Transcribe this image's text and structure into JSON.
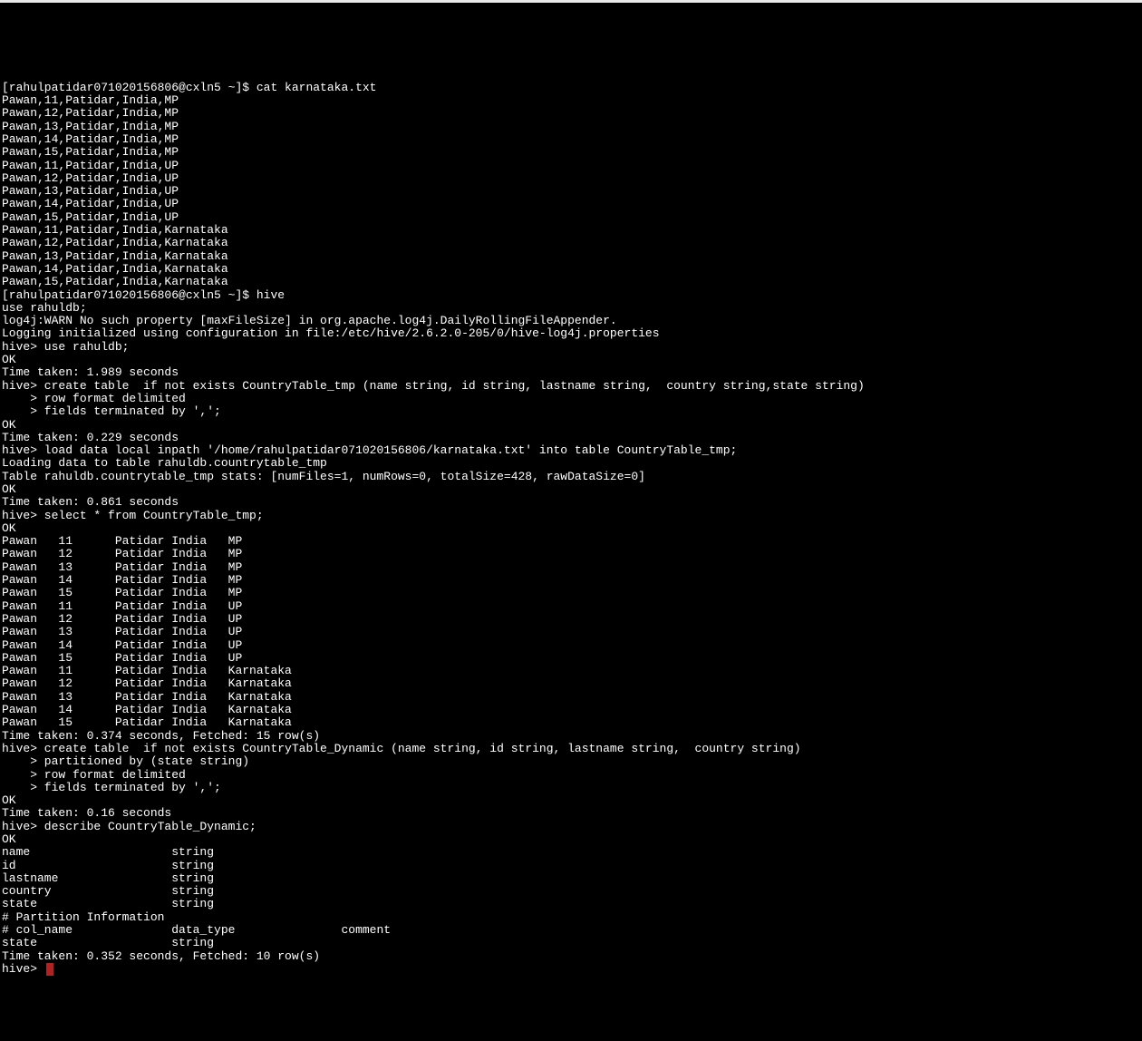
{
  "shell_user": "rahulpatidar071020156806",
  "shell_host": "cxln5",
  "cat_cmd": "[rahulpatidar071020156806@cxln5 ~]$ cat karnataka.txt",
  "cat_rows": [
    "Pawan,11,Patidar,India,MP",
    "Pawan,12,Patidar,India,MP",
    "Pawan,13,Patidar,India,MP",
    "Pawan,14,Patidar,India,MP",
    "Pawan,15,Patidar,India,MP",
    "Pawan,11,Patidar,India,UP",
    "Pawan,12,Patidar,India,UP",
    "Pawan,13,Patidar,India,UP",
    "Pawan,14,Patidar,India,UP",
    "Pawan,15,Patidar,India,UP",
    "Pawan,11,Patidar,India,Karnataka",
    "Pawan,12,Patidar,India,Karnataka",
    "Pawan,13,Patidar,India,Karnataka",
    "Pawan,14,Patidar,India,Karnataka",
    "Pawan,15,Patidar,India,Karnataka"
  ],
  "hive_cmd": "[rahulpatidar071020156806@cxln5 ~]$ hive",
  "use_db": "use rahuldb;",
  "log4j_warn": "log4j:WARN No such property [maxFileSize] in org.apache.log4j.DailyRollingFileAppender.",
  "blank": "",
  "logging_init": "Logging initialized using configuration in file:/etc/hive/2.6.2.0-205/0/hive-log4j.properties",
  "hive_use": "hive> use rahuldb;",
  "ok": "OK",
  "time_use": "Time taken: 1.989 seconds",
  "create_tmp_l1": "hive> create table  if not exists CountryTable_tmp (name string, id string, lastname string,  country string,state string)",
  "create_tmp_l2": "    > row format delimited",
  "create_tmp_l3": "    > fields terminated by ',';",
  "time_create_tmp": "Time taken: 0.229 seconds",
  "load_cmd": "hive> load data local inpath '/home/rahulpatidar071020156806/karnataka.txt' into table CountryTable_tmp;",
  "loading": "Loading data to table rahuldb.countrytable_tmp",
  "stats": "Table rahuldb.countrytable_tmp stats: [numFiles=1, numRows=0, totalSize=428, rawDataSize=0]",
  "time_load": "Time taken: 0.861 seconds",
  "select_cmd": "hive> select * from CountryTable_tmp;",
  "select_rows": [
    {
      "name": "Pawan",
      "id": "11",
      "ln": "Patidar",
      "country": "India",
      "state": "MP"
    },
    {
      "name": "Pawan",
      "id": "12",
      "ln": "Patidar",
      "country": "India",
      "state": "MP"
    },
    {
      "name": "Pawan",
      "id": "13",
      "ln": "Patidar",
      "country": "India",
      "state": "MP"
    },
    {
      "name": "Pawan",
      "id": "14",
      "ln": "Patidar",
      "country": "India",
      "state": "MP"
    },
    {
      "name": "Pawan",
      "id": "15",
      "ln": "Patidar",
      "country": "India",
      "state": "MP"
    },
    {
      "name": "Pawan",
      "id": "11",
      "ln": "Patidar",
      "country": "India",
      "state": "UP"
    },
    {
      "name": "Pawan",
      "id": "12",
      "ln": "Patidar",
      "country": "India",
      "state": "UP"
    },
    {
      "name": "Pawan",
      "id": "13",
      "ln": "Patidar",
      "country": "India",
      "state": "UP"
    },
    {
      "name": "Pawan",
      "id": "14",
      "ln": "Patidar",
      "country": "India",
      "state": "UP"
    },
    {
      "name": "Pawan",
      "id": "15",
      "ln": "Patidar",
      "country": "India",
      "state": "UP"
    },
    {
      "name": "Pawan",
      "id": "11",
      "ln": "Patidar",
      "country": "India",
      "state": "Karnataka"
    },
    {
      "name": "Pawan",
      "id": "12",
      "ln": "Patidar",
      "country": "India",
      "state": "Karnataka"
    },
    {
      "name": "Pawan",
      "id": "13",
      "ln": "Patidar",
      "country": "India",
      "state": "Karnataka"
    },
    {
      "name": "Pawan",
      "id": "14",
      "ln": "Patidar",
      "country": "India",
      "state": "Karnataka"
    },
    {
      "name": "Pawan",
      "id": "15",
      "ln": "Patidar",
      "country": "India",
      "state": "Karnataka"
    }
  ],
  "time_select": "Time taken: 0.374 seconds, Fetched: 15 row(s)",
  "create_dyn_l1": "hive> create table  if not exists CountryTable_Dynamic (name string, id string, lastname string,  country string)",
  "create_dyn_l2": "    > partitioned by (state string)",
  "create_dyn_l3": "    > row format delimited",
  "create_dyn_l4": "    > fields terminated by ',';",
  "time_create_dyn": "Time taken: 0.16 seconds",
  "describe_cmd": "hive> describe CountryTable_Dynamic;",
  "describe_rows": [
    {
      "col": "name",
      "type": "string"
    },
    {
      "col": "id",
      "type": "string"
    },
    {
      "col": "lastname",
      "type": "string"
    },
    {
      "col": "country",
      "type": "string"
    },
    {
      "col": "state",
      "type": "string"
    }
  ],
  "partition_header": "# Partition Information",
  "partition_cols_header": {
    "col": "# col_name",
    "type": "data_type",
    "comment": "comment"
  },
  "partition_row": {
    "col": "state",
    "type": "string"
  },
  "time_describe": "Time taken: 0.352 seconds, Fetched: 10 row(s)",
  "final_prompt": "hive> "
}
